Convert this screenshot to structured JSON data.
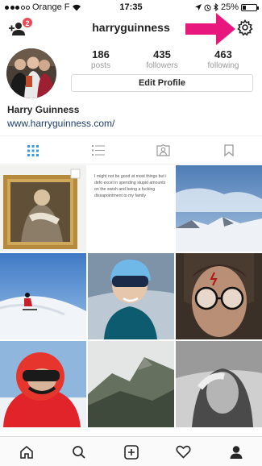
{
  "status_bar": {
    "carrier": "Orange F",
    "time": "17:35",
    "battery_percent": "25%",
    "battery_level": 0.25
  },
  "header": {
    "username": "harryguinness",
    "notification_count": "2"
  },
  "profile": {
    "stats": [
      {
        "value": "186",
        "label": "posts"
      },
      {
        "value": "435",
        "label": "followers"
      },
      {
        "value": "463",
        "label": "following"
      }
    ],
    "edit_label": "Edit Profile",
    "full_name": "Harry Guinness",
    "website": "www.harryguinness.com/"
  },
  "grid": {
    "quote": "I might not be good at most things but i defo excel in spending stupid amounts on the swish and being a fucking dissapointment to my family"
  },
  "colors": {
    "accent_pink": "#e8177e",
    "badge_red": "#ed4956",
    "link_blue": "#1f3c6b",
    "active_tab_blue": "#3897f0"
  }
}
